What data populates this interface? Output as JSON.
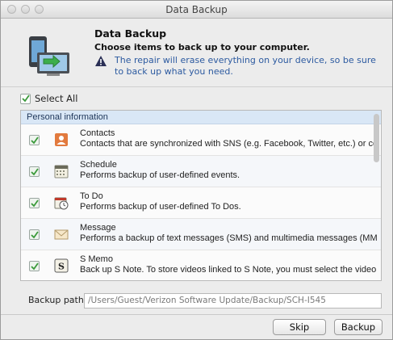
{
  "window": {
    "title": "Data Backup"
  },
  "header": {
    "title": "Data Backup",
    "subtitle": "Choose items to back up to your computer.",
    "warning": "The repair will erase everything on your device, so be sure to back up what you need."
  },
  "select_all": {
    "label": "Select All",
    "checked": true
  },
  "list": {
    "group": "Personal information",
    "items": [
      {
        "title": "Contacts",
        "desc": "Contacts that are synchronized with SNS (e.g. Facebook, Twitter, etc.) or co",
        "icon": "contacts-icon",
        "checked": true
      },
      {
        "title": "Schedule",
        "desc": "Performs backup of user-defined events.",
        "icon": "calendar-icon",
        "checked": true
      },
      {
        "title": "To Do",
        "desc": "Performs backup of user-defined To Dos.",
        "icon": "todo-icon",
        "checked": true
      },
      {
        "title": "Message",
        "desc": "Performs a backup of text messages (SMS) and multimedia messages (MM",
        "icon": "envelope-icon",
        "checked": true
      },
      {
        "title": "S Memo",
        "desc": "Back up S Note. To store videos linked to S Note, you must select the video",
        "icon": "s-memo-icon",
        "checked": true
      }
    ]
  },
  "backup_path": {
    "label": "Backup path:",
    "value": "/Users/Guest/Verizon Software Update/Backup/SCH-I545"
  },
  "buttons": {
    "skip": "Skip",
    "backup": "Backup"
  },
  "colors": {
    "warning_text": "#2c5aa0",
    "group_header_bg": "#d9e7f6",
    "check_green": "#3a9a3a"
  }
}
